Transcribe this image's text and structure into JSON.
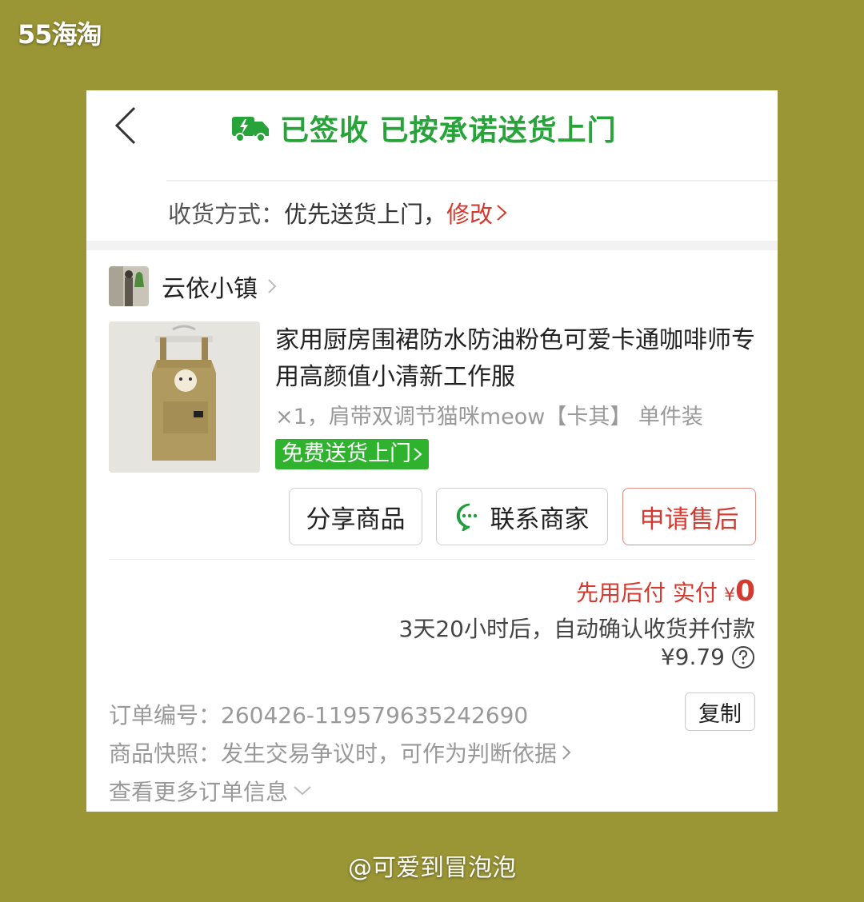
{
  "watermark": {
    "top": "55海淘",
    "bottom": "@可爱到冒泡泡"
  },
  "header": {
    "status": "已签收 已按承诺送货上门"
  },
  "delivery": {
    "label": "收货方式：",
    "value": "优先送货上门，",
    "modify": "修改"
  },
  "shop": {
    "name": "云依小镇"
  },
  "product": {
    "title": "家用厨房围裙防水防油粉色可爱卡通咖啡师专用高颜值小清新工作服",
    "spec": "×1，肩带双调节猫咪meow【卡其】 单件装",
    "badge": "免费送货上门"
  },
  "actions": {
    "share": "分享商品",
    "contact": "联系商家",
    "after_sale": "申请售后"
  },
  "payment": {
    "label": "先用后付 实付",
    "currency": "¥",
    "amount": "0",
    "auto_confirm": "3天20小时后，自动确认收货并付款",
    "price": "¥9.79"
  },
  "order": {
    "number_label": "订单编号：",
    "number": "260426-119579635242690",
    "copy": "复制",
    "snapshot": "商品快照：发生交易争议时，可作为判断依据",
    "more": "查看更多订单信息"
  },
  "colors": {
    "green": "#27a33a",
    "red": "#d43a2f",
    "background": "#9a9535"
  }
}
